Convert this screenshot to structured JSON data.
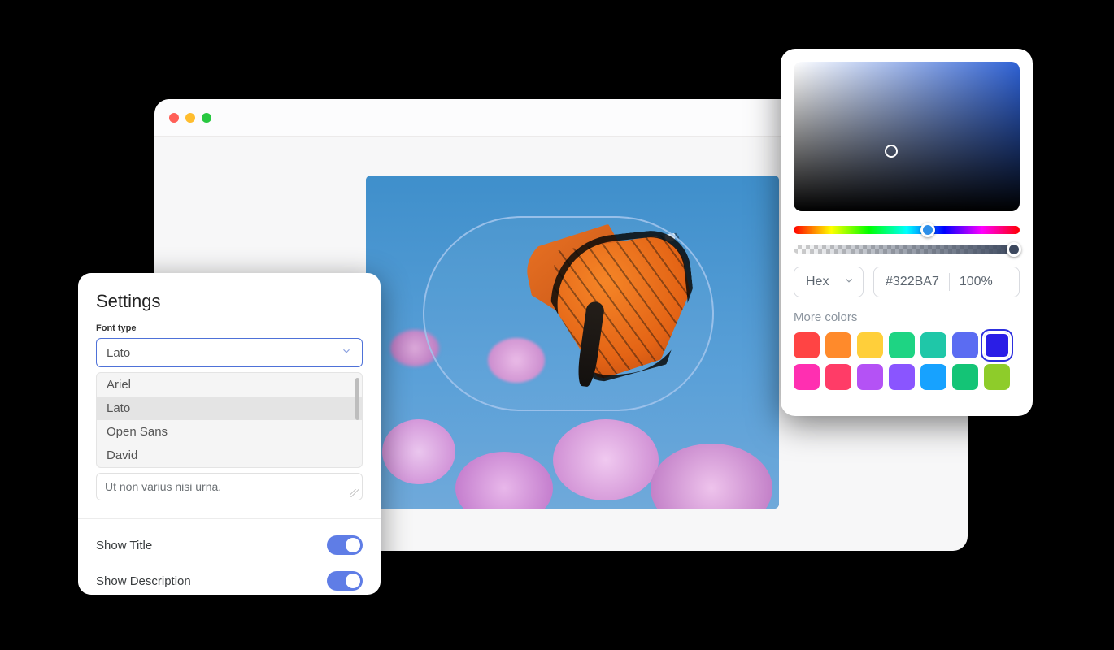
{
  "settings": {
    "title": "Settings",
    "font_type_label": "Font type",
    "font_selected": "Lato",
    "font_options": [
      "Ariel",
      "Lato",
      "Open Sans",
      "David"
    ],
    "textarea_value": "Ut non varius nisi urna.",
    "show_title_label": "Show Title",
    "show_title_on": true,
    "show_description_label": "Show Description",
    "show_description_on": true
  },
  "picker": {
    "format": "Hex",
    "hex_value": "#322BA7",
    "opacity": "100%",
    "more_label": "More colors",
    "swatches": [
      "#ff4444",
      "#ff8a2b",
      "#ffcf3a",
      "#1ed483",
      "#1fc7a8",
      "#5b6cf2",
      "#2a1ee6",
      "#ff2fb1",
      "#ff3c67",
      "#b452f5",
      "#8a55ff",
      "#17a2ff",
      "#14c476",
      "#8ecc2a"
    ],
    "selected_swatch_index": 6
  }
}
